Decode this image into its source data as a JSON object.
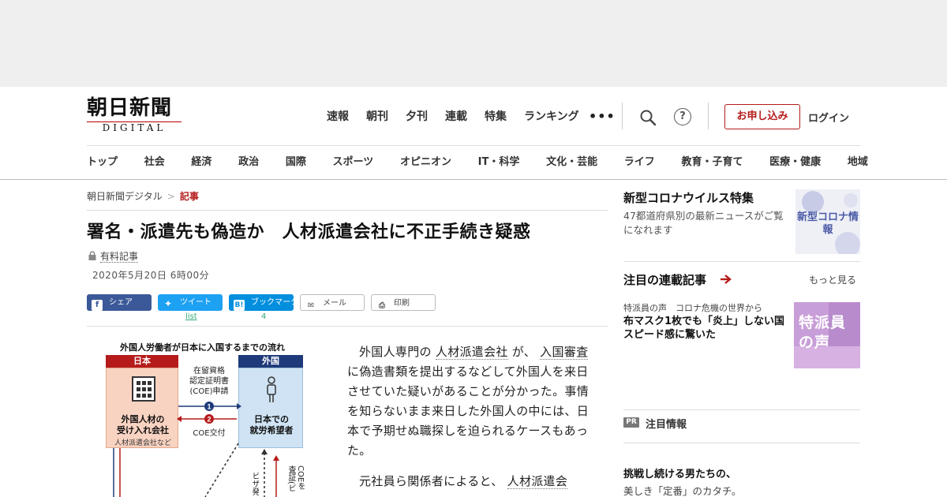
{
  "ad_band": {},
  "header": {
    "logo_main": "朝日新聞",
    "logo_sub": "DIGITAL",
    "top_nav": [
      "速報",
      "朝刊",
      "夕刊",
      "連載",
      "特集",
      "ランキング"
    ],
    "more": "•••",
    "help_glyph": "?",
    "apply_label": "お申し込み",
    "login_label": "ログイン",
    "category_nav": [
      "トップ",
      "社会",
      "経済",
      "政治",
      "国際",
      "スポーツ",
      "オピニオン",
      "IT・科学",
      "文化・芸能",
      "ライフ",
      "教育・子育て",
      "医療・健康",
      "地域"
    ]
  },
  "breadcrumb": {
    "home": "朝日新聞デジタル",
    "sep": ">",
    "current": "記事"
  },
  "article": {
    "title": "署名・派遣先も偽造か　人材派遣会社に不正手続き疑惑",
    "paid_label": "有料記事",
    "date": "2020年5月20日 6時00分",
    "share": {
      "facebook": "シェア",
      "twitter": "ツイート",
      "twitter_count": "list",
      "hatena": "ブックマーク",
      "hatena_count": "4",
      "mail": "メール",
      "print": "印刷"
    },
    "figure": {
      "title": "外国人労働者が日本に入国するまでの流れ",
      "japan_head": "日本",
      "foreign_head": "外国",
      "japan_label_1": "外国人材の",
      "japan_label_2": "受け入れ会社",
      "japan_sub": "人材派遣会社など",
      "foreign_label_1": "日本での",
      "foreign_label_2": "就労希望者",
      "mid_label_1": "在留資格",
      "mid_label_2": "認定証明書",
      "mid_label_3": "(COE)申請",
      "step1": "1",
      "step2": "2",
      "coe_label": "COE交付",
      "visa_label": "ビザ発",
      "coe_check_label": "COEを査証(ビ"
    },
    "paragraph1": {
      "t1": "外国人専門の",
      "k1": "人材派遣会社",
      "t2": "が、",
      "k2": "入国審査",
      "t3": "に偽造書類を提出するなどして外国人を来日させていた疑いがあることが分かった。事情を知らないまま来日した外国人の中には、日本で予期せぬ職探しを迫られるケースもあった。"
    },
    "paragraph2": {
      "t1": "元社員ら関係者によると、",
      "k1": "人材派遣会"
    }
  },
  "sidebar": {
    "corona_title": "新型コロナウイルス特集",
    "corona_desc": "47都道府県別の最新ニュースがご覧になれます",
    "corona_thumb": "新型コロナ情報",
    "series_head": "注目の連載記事",
    "more_label": "もっと見る",
    "series_kicker": "特派員の声　コロナ危機の世界から",
    "series_title": "布マスク1枚でも「炎上」しない国　スピード感に驚いた",
    "series_thumb_1": "特派員",
    "series_thumb_2": "の声",
    "pr_badge": "PR",
    "pr_head": "注目情報",
    "promo_title": "挑戦し続ける男たちの、",
    "promo_sub": "美しき「定番」のカタチ。"
  },
  "colors": {
    "brand_red": "#b51b1b",
    "facebook": "#3b5998",
    "twitter": "#1da1f2",
    "hatena": "#008fde",
    "japan_box": "#f9d3c2",
    "foreign_box": "#cfe3f4",
    "foreign_head": "#1e3a7a"
  }
}
